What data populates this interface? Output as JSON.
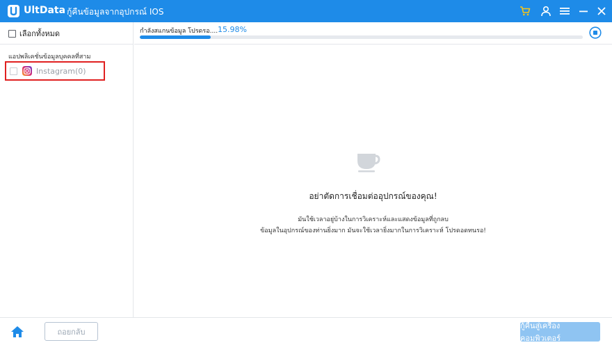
{
  "titlebar": {
    "app_name": "UltData",
    "subtitle": "-  กู้คืนข้อมูลจากอุปกรณ์ IOS",
    "icons": [
      "cart-icon",
      "user-icon",
      "menu-icon",
      "minimize-icon",
      "close-icon"
    ]
  },
  "sidebar": {
    "select_all_label": "เลือกทั้งหมด",
    "section_label": "แอปพลิเคชั่นข้อมูลบุคคลที่สาม",
    "items": [
      {
        "label": "Instagram(0)",
        "icon": "instagram-icon"
      }
    ]
  },
  "scan": {
    "status_text": "กำลังสแกนข้อมูล   โปรดรอ....",
    "percent_text": "15.98%",
    "progress_fraction": 0.1598
  },
  "main": {
    "headline": "อย่าตัดการเชื่อมต่ออุปกรณ์ของคุณ!",
    "desc_line1": "มันใช้เวลาอยู่บ้างในการวิเคราะห์และแสดงข้อมูลที่ถูกลบ",
    "desc_line2": "ข้อมูลในอุปกรณ์ของท่านยิ่งมาก   มันจะใช้เวลายิ่งมากในการวิเคราะห์ โปรดอดทนรอ!"
  },
  "bottombar": {
    "back_label": "ถอยกลับ",
    "recover_label": "กู้คืนสู่เครื่องคอมพิวเตอร์"
  },
  "colors": {
    "accent": "#1e8be8",
    "highlight_border": "#e02020",
    "cart": "#f5c518"
  }
}
